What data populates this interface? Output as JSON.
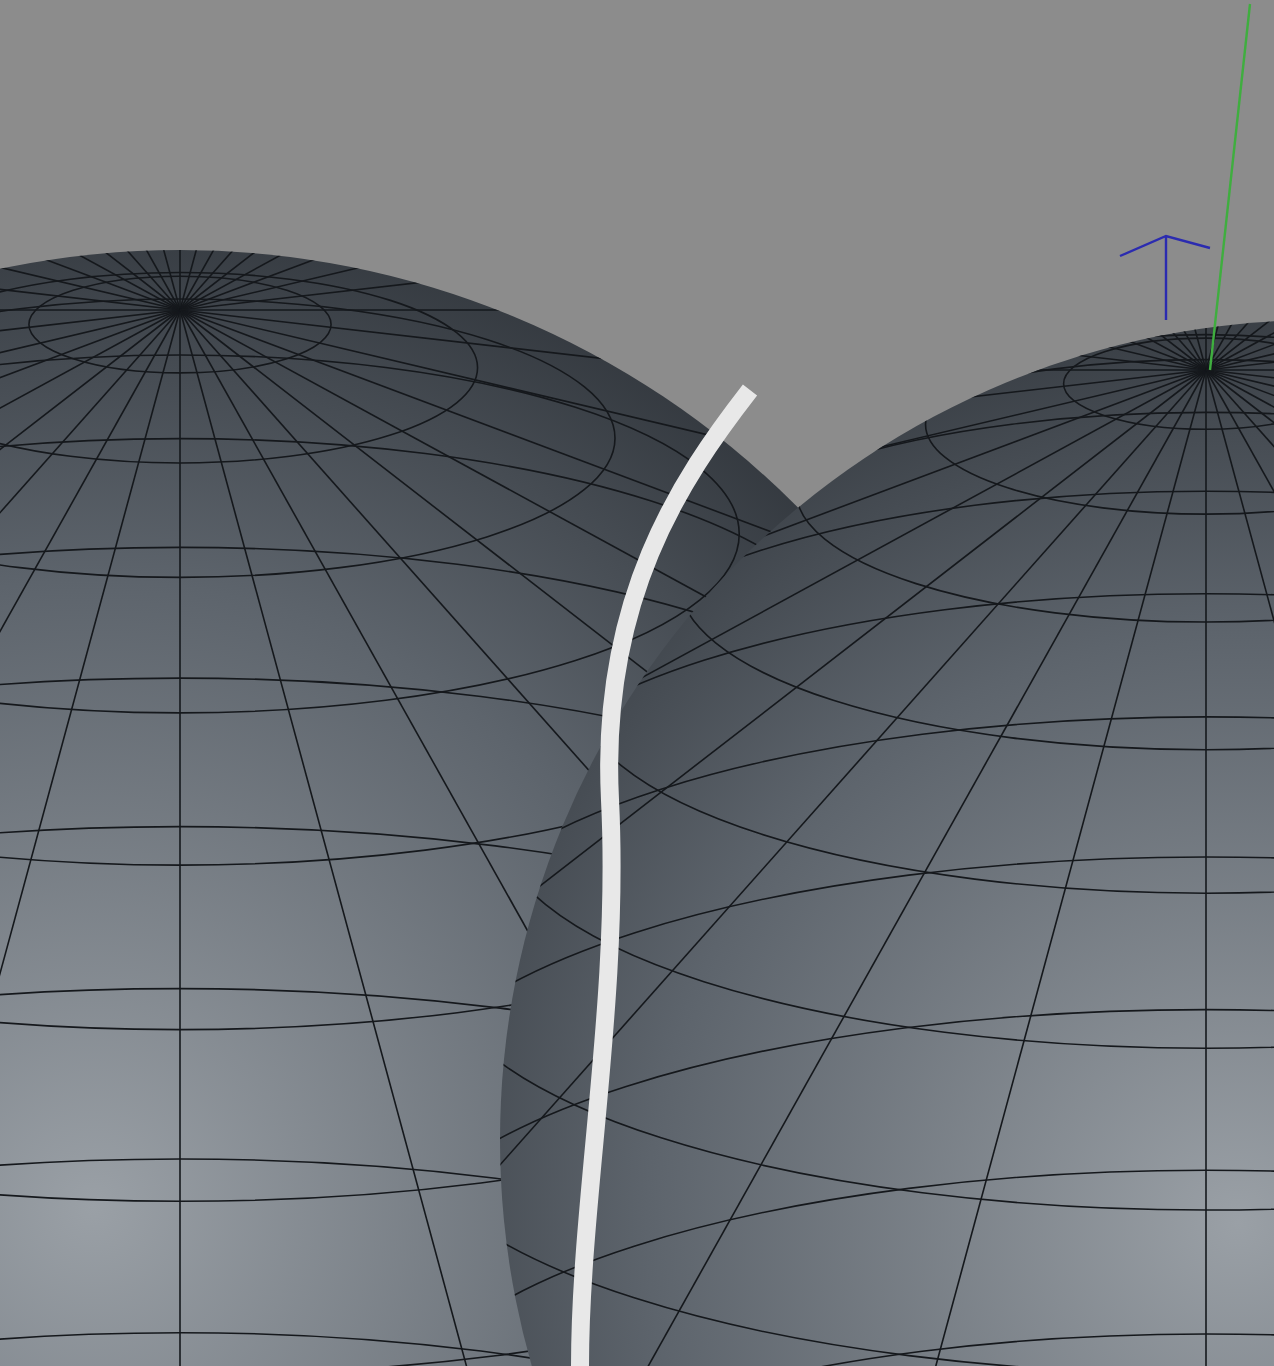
{
  "viewport": {
    "objects": [
      {
        "kind": "sphere"
      },
      {
        "kind": "sphere"
      },
      {
        "kind": "spline"
      },
      {
        "kind": "axis"
      }
    ]
  }
}
